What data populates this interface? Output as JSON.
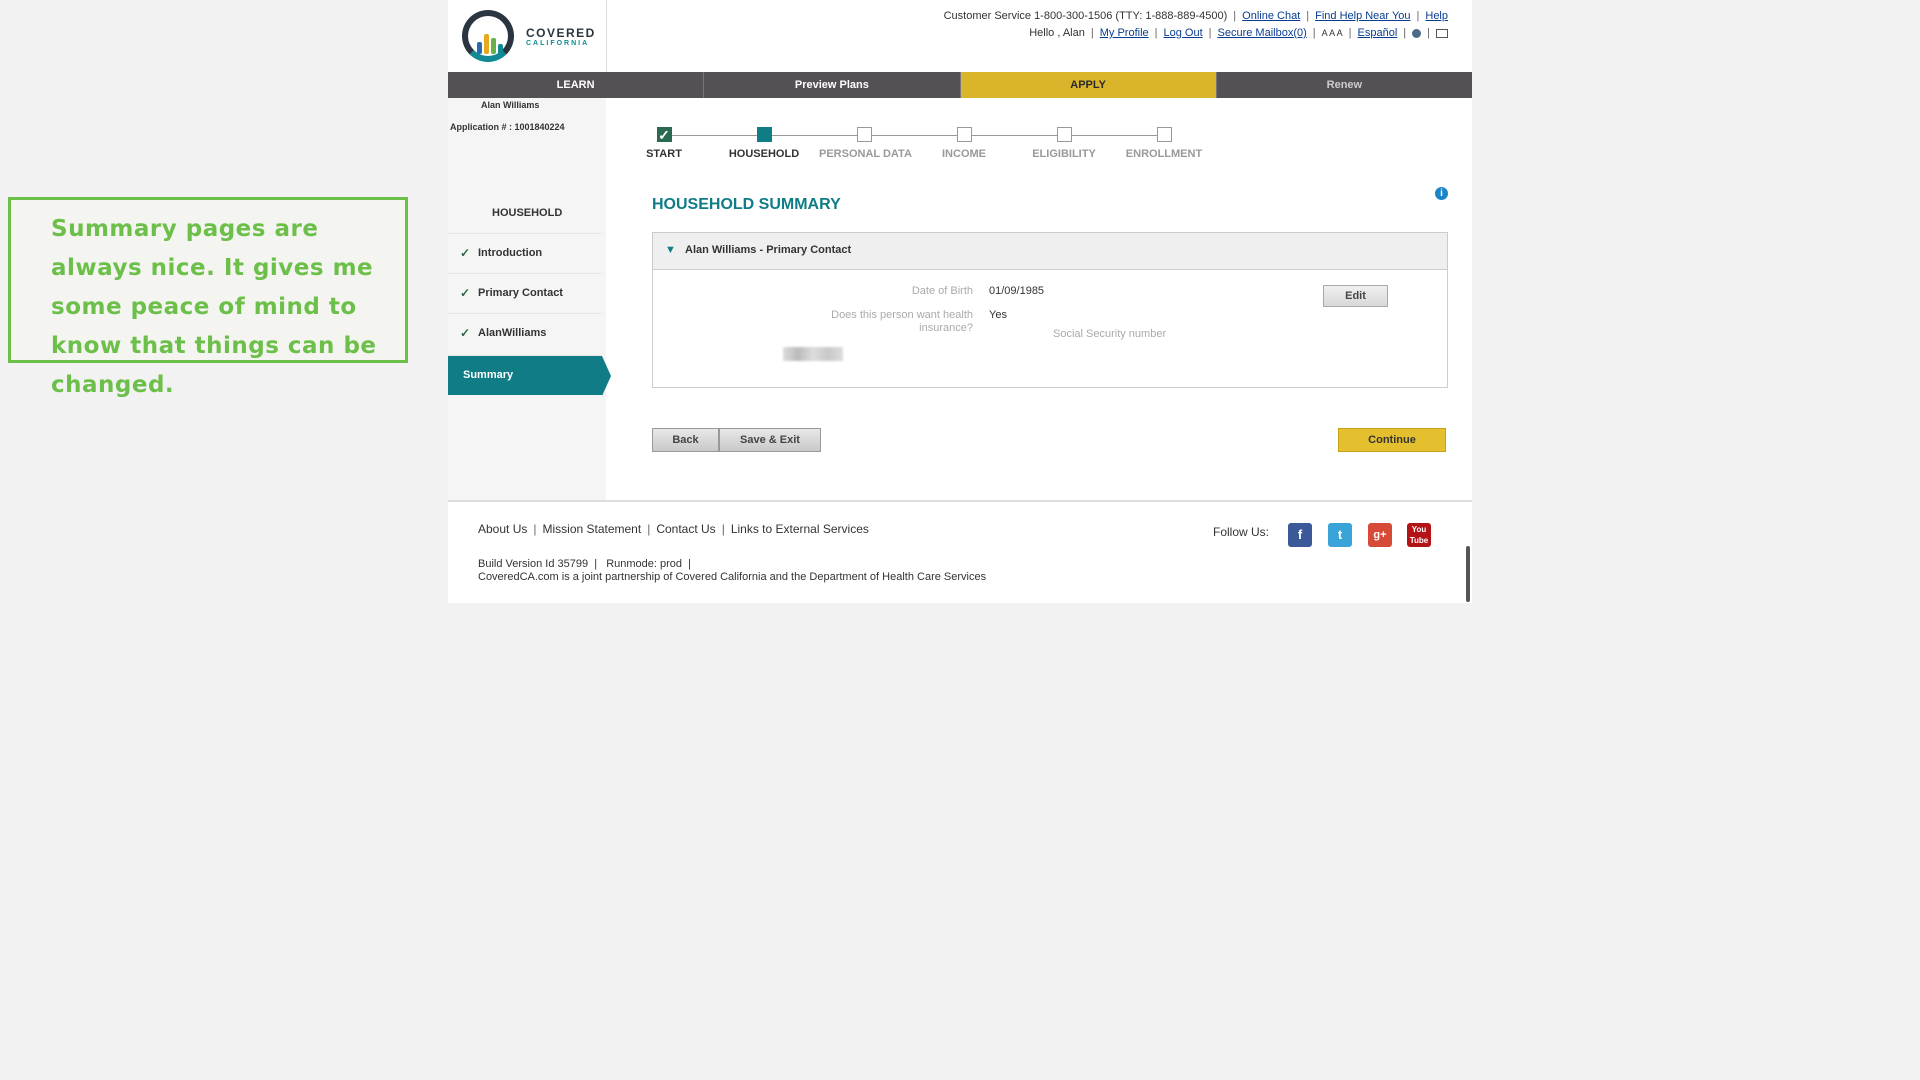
{
  "annotation": {
    "text": "Summary pages are always nice. It gives me some peace of mind to know that things can be changed."
  },
  "logo": {
    "line1": "COVERED",
    "line2": "CALIFORNIA"
  },
  "topbar": {
    "customer_service": "Customer Service 1-800-300-1506 (TTY: 1-888-889-4500)",
    "online_chat": "Online Chat",
    "find_help": "Find Help Near You",
    "help": "Help",
    "greeting": "Hello , Alan",
    "my_profile": "My Profile",
    "log_out": "Log Out",
    "secure_mailbox": "Secure Mailbox(0)",
    "text_size": "A A A",
    "espanol": "Español"
  },
  "nav": {
    "learn": "LEARN",
    "preview": "Preview Plans",
    "apply": "APPLY",
    "renew": "Renew"
  },
  "sidebar": {
    "applicant": "Alan Williams",
    "application_number": "Application # : 1001840224",
    "heading": "HOUSEHOLD",
    "items": [
      {
        "label": "Introduction",
        "check": "✓"
      },
      {
        "label": "Primary Contact",
        "check": "✓"
      },
      {
        "label": "AlanWilliams",
        "check": "✓"
      },
      {
        "label": "Summary"
      }
    ]
  },
  "progress": {
    "steps": [
      {
        "label": "START",
        "state": "done"
      },
      {
        "label": "HOUSEHOLD",
        "state": "current"
      },
      {
        "label": "PERSONAL DATA",
        "state": "pending"
      },
      {
        "label": "INCOME",
        "state": "pending"
      },
      {
        "label": "ELIGIBILITY",
        "state": "pending"
      },
      {
        "label": "ENROLLMENT",
        "state": "pending"
      }
    ]
  },
  "main": {
    "title": "HOUSEHOLD SUMMARY",
    "panel_title": "Alan Williams - Primary Contact",
    "dob_label": "Date of Birth",
    "dob_value": "01/09/1985",
    "insurance_label": "Does this person want health insurance?",
    "insurance_value": "Yes",
    "ssn_label": "Social Security number",
    "edit": "Edit",
    "back": "Back",
    "save_exit": "Save & Exit",
    "continue": "Continue"
  },
  "footer": {
    "about": "About Us",
    "mission": "Mission Statement",
    "contact": "Contact Us",
    "links": "Links to External Services",
    "follow": "Follow Us:",
    "build": "Build Version Id 35799  |   Runmode: prod  |",
    "partnership": "CoveredCA.com is a joint partnership of Covered California and the Department of Health Care Services"
  },
  "colors": {
    "teal": "#0f7c86",
    "gold": "#dab42a",
    "annotation_green": "#6cc04a"
  }
}
